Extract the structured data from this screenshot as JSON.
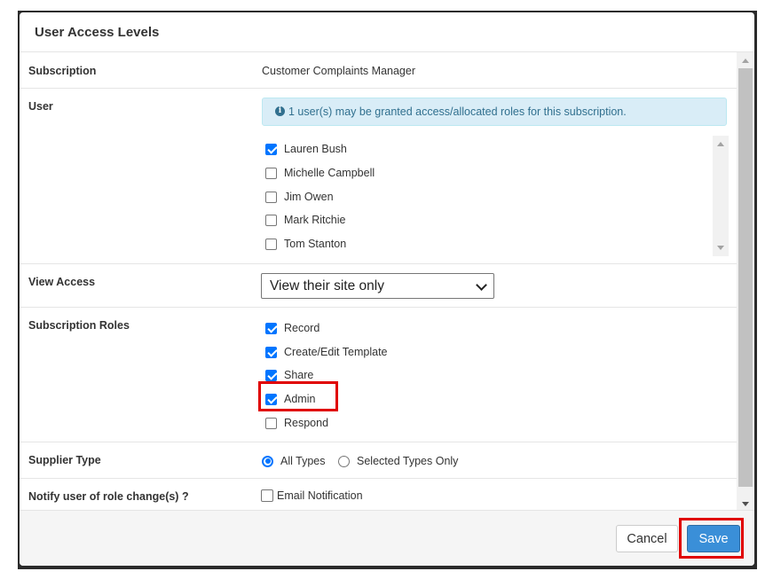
{
  "dialog": {
    "title": "User Access Levels"
  },
  "subscription": {
    "label": "Subscription",
    "value": "Customer Complaints Manager"
  },
  "user": {
    "label": "User",
    "info_message": "1 user(s) may be granted access/allocated roles for this subscription.",
    "info_icon": "info-circle-icon",
    "users": [
      {
        "name": "Lauren Bush",
        "checked": true
      },
      {
        "name": "Michelle Campbell",
        "checked": false
      },
      {
        "name": "Jim Owen",
        "checked": false
      },
      {
        "name": "Mark Ritchie",
        "checked": false
      },
      {
        "name": "Tom Stanton",
        "checked": false
      }
    ]
  },
  "view_access": {
    "label": "View Access",
    "selected": "View their site only"
  },
  "subscription_roles": {
    "label": "Subscription Roles",
    "roles": [
      {
        "name": "Record",
        "checked": true
      },
      {
        "name": "Create/Edit Template",
        "checked": true
      },
      {
        "name": "Share",
        "checked": true
      },
      {
        "name": "Admin",
        "checked": true
      },
      {
        "name": "Respond",
        "checked": false
      }
    ]
  },
  "supplier_type": {
    "label": "Supplier Type",
    "options": [
      {
        "name": "All Types",
        "selected": true
      },
      {
        "name": "Selected Types Only",
        "selected": false
      }
    ]
  },
  "notify": {
    "label": "Notify user of role change(s) ?",
    "option": "Email Notification",
    "checked": false
  },
  "footer": {
    "cancel_label": "Cancel",
    "save_label": "Save"
  },
  "colors": {
    "accent": "#0075ff",
    "save_button": "#3a8fd8",
    "info_bg": "#d9edf7",
    "highlight": "#e00000"
  }
}
